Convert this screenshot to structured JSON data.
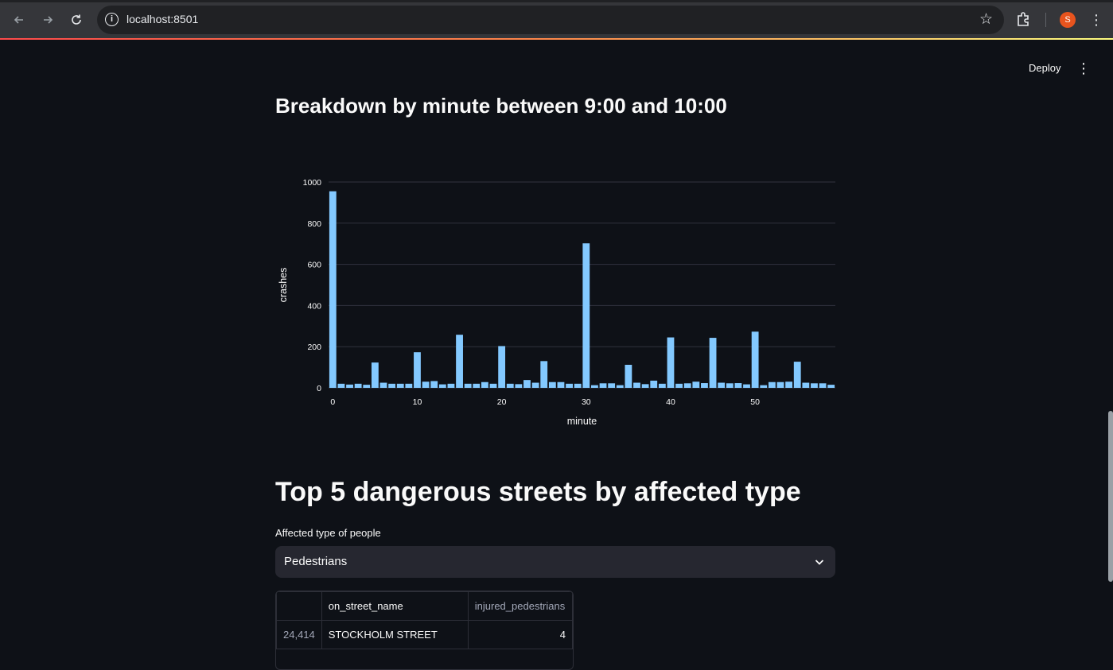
{
  "browser": {
    "url": "localhost:8501",
    "profile_initial": "S",
    "icons": [
      "back-icon",
      "forward-icon",
      "reload-icon",
      "info-icon",
      "star-icon",
      "extensions-icon",
      "menu-dots-icon"
    ]
  },
  "app_header": {
    "deploy_label": "Deploy"
  },
  "section_minute": {
    "title": "Breakdown by minute between 9:00 and 10:00"
  },
  "chart_data": {
    "type": "bar",
    "xlabel": "minute",
    "ylabel": "crashes",
    "xlim": [
      0,
      59
    ],
    "ylim": [
      0,
      1000
    ],
    "x_ticks": [
      "0",
      "10",
      "20",
      "30",
      "40",
      "50"
    ],
    "y_ticks": [
      "0",
      "200",
      "400",
      "600",
      "800",
      "1000"
    ],
    "bar_color": "#83c9ff",
    "grid": true,
    "x": [
      0,
      1,
      2,
      3,
      4,
      5,
      6,
      7,
      8,
      9,
      10,
      11,
      12,
      13,
      14,
      15,
      16,
      17,
      18,
      19,
      20,
      21,
      22,
      23,
      24,
      25,
      26,
      27,
      28,
      29,
      30,
      31,
      32,
      33,
      34,
      35,
      36,
      37,
      38,
      39,
      40,
      41,
      42,
      43,
      44,
      45,
      46,
      47,
      48,
      49,
      50,
      51,
      52,
      53,
      54,
      55,
      56,
      57,
      58,
      59
    ],
    "values": [
      955,
      20,
      16,
      20,
      15,
      123,
      25,
      20,
      20,
      20,
      173,
      30,
      33,
      17,
      20,
      258,
      20,
      20,
      28,
      20,
      203,
      20,
      18,
      38,
      25,
      130,
      28,
      28,
      20,
      20,
      702,
      13,
      22,
      22,
      13,
      112,
      25,
      18,
      35,
      20,
      245,
      20,
      22,
      30,
      23,
      243,
      25,
      22,
      23,
      17,
      273,
      13,
      28,
      28,
      30,
      127,
      25,
      22,
      22,
      15
    ]
  },
  "section_streets": {
    "title": "Top 5 dangerous streets by affected type",
    "select_label": "Affected type of people",
    "select_value": "Pedestrians"
  },
  "table": {
    "columns": [
      "",
      "on_street_name",
      "injured_pedestrians"
    ],
    "rows": [
      {
        "index": "24,414",
        "on_street_name": "STOCKHOLM STREET",
        "injured_pedestrians": "4"
      }
    ]
  },
  "colors": {
    "background": "#0e1117",
    "accent": "#ff4b4b",
    "bar": "#83c9ff",
    "select_bg": "#262730"
  }
}
